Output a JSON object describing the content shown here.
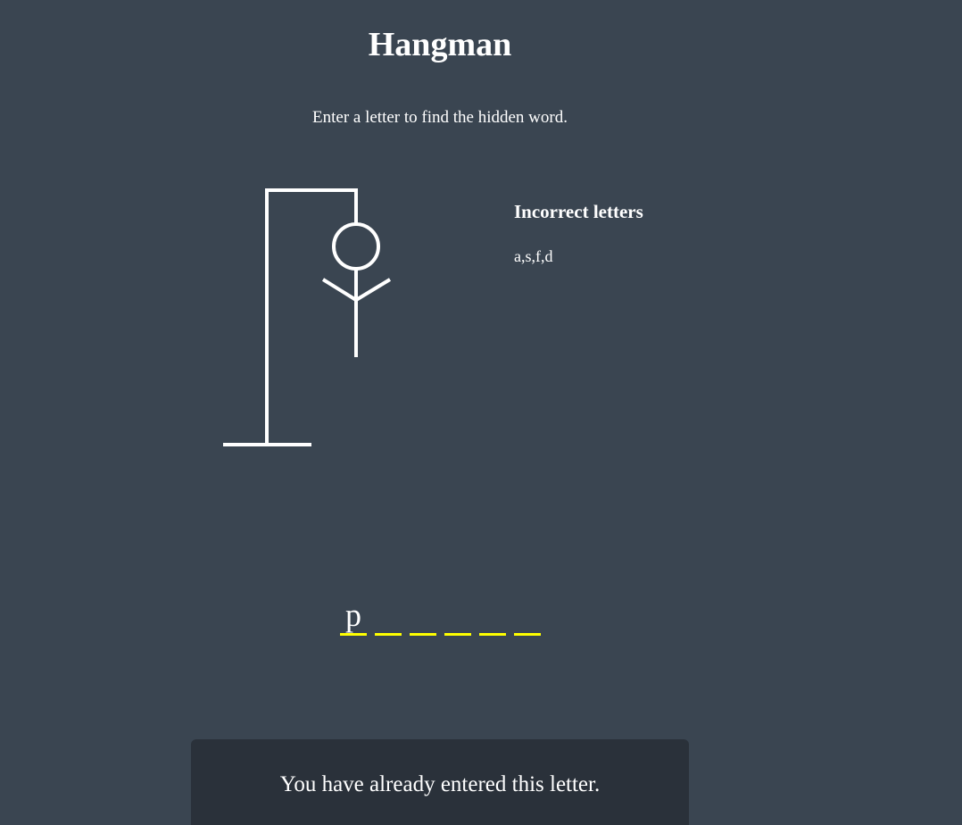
{
  "header": {
    "title": "Hangman",
    "subtitle": "Enter a letter to find the hidden word."
  },
  "gallows": {
    "parts_drawn": [
      "base",
      "pole",
      "beam",
      "rope",
      "head",
      "body",
      "left-arm",
      "right-arm"
    ]
  },
  "wrong_letters": {
    "heading": "Incorrect letters",
    "letters": "a,s,f,d"
  },
  "word": {
    "slots": [
      "p",
      "",
      "",
      "",
      "",
      ""
    ]
  },
  "notification": {
    "text": "You have already entered this letter."
  },
  "colors": {
    "background": "#3a4551",
    "notification_bg": "#2a313a",
    "slot_underline": "#ffff00",
    "text": "#ffffff"
  }
}
